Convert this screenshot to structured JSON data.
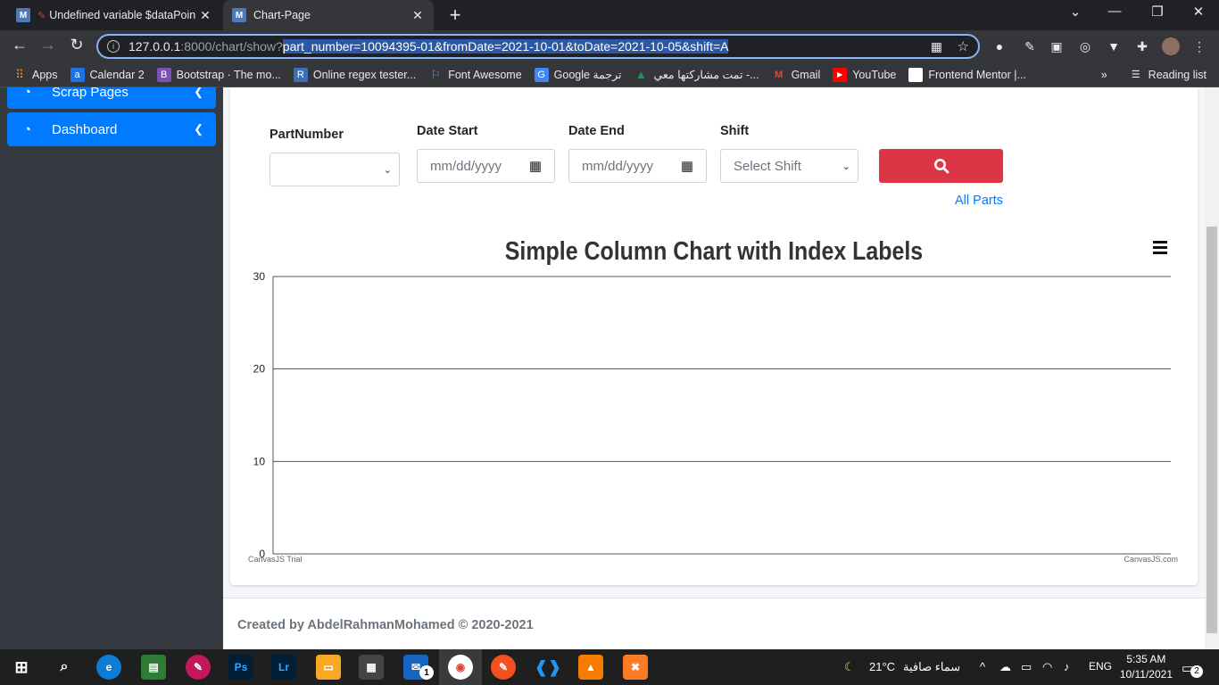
{
  "browser": {
    "tabs": [
      {
        "title": "Undefined variable $dataPoin",
        "favicon": "M"
      },
      {
        "title": "Chart-Page",
        "favicon": "M"
      }
    ],
    "url": {
      "host": "127.0.0.1",
      "path": ":8000/chart/show?",
      "query": "part_number=10094395-01&fromDate=2021-10-01&toDate=2021-10-05&shift=A"
    },
    "bookmarks": [
      {
        "label": "Apps",
        "icon": "apps-grid-icon",
        "color": "#e8710a"
      },
      {
        "label": "Calendar 2",
        "icon": "a",
        "color": "#1a73e8"
      },
      {
        "label": "Bootstrap · The mo...",
        "icon": "B",
        "color": "#7952b3"
      },
      {
        "label": "Online regex tester...",
        "icon": "R",
        "color": "#3b6fb6"
      },
      {
        "label": "Font Awesome",
        "icon": "flag-icon",
        "color": "#4a8fe7"
      },
      {
        "label": "Google ترجمة",
        "icon": "G",
        "color": "#4285f4"
      },
      {
        "label": "تمت مشاركتها معي -...",
        "icon": "drive-icon",
        "color": "#0f9d58"
      },
      {
        "label": "Gmail",
        "icon": "M",
        "color": "#ea4335"
      },
      {
        "label": "YouTube",
        "icon": "play-icon",
        "color": "#ff0000"
      },
      {
        "label": "Frontend Mentor |...",
        "icon": "fm-icon",
        "color": "#ffffff"
      }
    ],
    "reading_list": "Reading list",
    "more": "»"
  },
  "sidebar": {
    "items": [
      {
        "label": "Scrap Pages"
      },
      {
        "label": "Dashboard"
      }
    ]
  },
  "form": {
    "part_number_label": "PartNumber",
    "date_start_label": "Date Start",
    "date_start_placeholder": "mm/dd/yyyy",
    "date_end_label": "Date End",
    "date_end_placeholder": "mm/dd/yyyy",
    "shift_label": "Shift",
    "shift_selected": "Select Shift",
    "all_parts": "All Parts"
  },
  "chart_data": {
    "type": "bar",
    "title": "Simple Column Chart with Index Labels",
    "categories": [],
    "values": [],
    "ylim": [
      0,
      30
    ],
    "yticks": [
      "30",
      "20",
      "10",
      "0"
    ],
    "xlabel": "",
    "ylabel": "",
    "grid": true,
    "watermark_left": "CanvasJS Trial",
    "watermark_right": "CanvasJS.com"
  },
  "footer": {
    "text": "Created by AbdelRahmanMohamed © 2020-2021"
  },
  "taskbar": {
    "weather_temp": "21°C",
    "weather_text": "سماء صافية",
    "language": "ENG",
    "time": "5:35 AM",
    "date": "10/11/2021",
    "notifications": "2",
    "mail_badge": "1"
  }
}
